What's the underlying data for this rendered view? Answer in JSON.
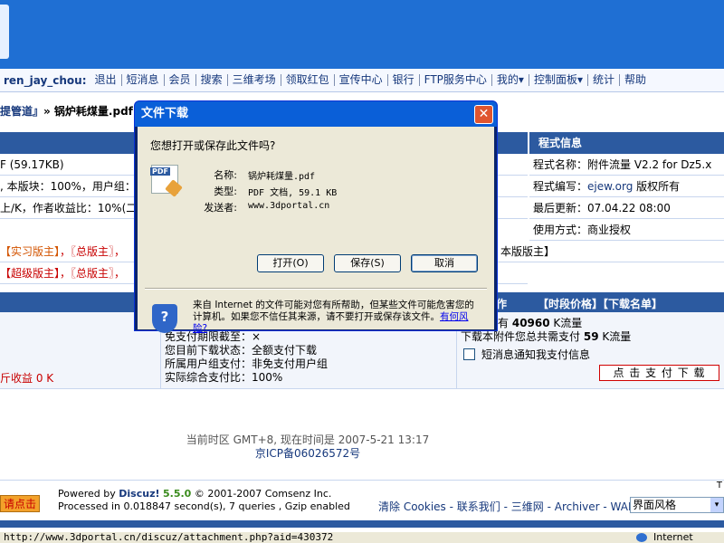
{
  "nav": {
    "username": "ren_jay_chou:",
    "items": [
      "退出",
      "短消息",
      "会员",
      "搜索",
      "三维考场",
      "领取红包",
      "宣传中心",
      "银行",
      "FTP服务中心",
      "我的▾",
      "控制面板▾",
      "统计",
      "帮助"
    ]
  },
  "breadcrumb": {
    "left": "提管道』",
    "file": "» 锅炉耗煤量.pdf"
  },
  "program_info": {
    "header": "程式信息",
    "name": "程式名称：附件流量 V2.2 for Dz5.x",
    "author_prefix": "程式编写：",
    "author_link": "ejew.org",
    "author_suffix": " 版权所有",
    "updated": "最后更新：07.04.22 08:00",
    "usage": "使用方式：商业授权"
  },
  "left_rows": {
    "row1": "F (59.17KB)",
    "row2": ", 本版块：100%，用户组：",
    "row3": "上/K，作者收益比：10%(二次",
    "row4_a": "【实习版主】",
    "row4_b": "，〖总版主〗，",
    "row4_c": "本版版主】",
    "row5_a": "【超级版主】",
    "row5_b": "，〖总版主〗，"
  },
  "lower": {
    "header_left": "作",
    "header_right": "【时段价格】【下载名单】",
    "free_period": "免支付期限截至：×",
    "download_status": "您目前下载状态：全额支付下载",
    "group_pay": "所属用户组支付：非免支付用户组",
    "actual_ratio": "实际综合支付比：100%",
    "left_income": "斤收益 0 K",
    "flow_prefix": "有",
    "flow_value": "40960",
    "flow_suffix": "K流量",
    "need_prefix": "下载本附件您总共需支付",
    "need_value": "59",
    "need_suffix": "K流量",
    "notify": "短消息通知我支付信息",
    "pay_button": "点 击 支 付 下 载"
  },
  "footer": {
    "timezone": "当前时区 GMT+8, 现在时间是 2007-5-21 13:17",
    "icp": "京ICP备06026572号",
    "left_button": "请点击",
    "powered_prefix": "Powered by ",
    "powered_brand": "Discuz!",
    "powered_version": "5.5.0",
    "copyright": "© 2001-2007 Comsenz Inc.",
    "processed": "Processed in 0.018847 second(s), 7 queries , Gzip enabled",
    "links": [
      "清除 Cookies",
      "联系我们",
      "三维网",
      "Archiver",
      "WAP"
    ],
    "style_select": "界面风格",
    "top_link": "T"
  },
  "statusbar": {
    "url": "http://www.3dportal.cn/discuz/attachment.php?aid=430372",
    "zone": "Internet"
  },
  "dialog": {
    "title": "文件下载",
    "question": "您想打开或保存此文件吗?",
    "name_label": "名称:",
    "name_value": "锅炉耗煤量.pdf",
    "type_label": "类型:",
    "type_value": "PDF 文档, 59.1 KB",
    "from_label": "发送者:",
    "from_value": "www.3dportal.cn",
    "open_button": "打开(O)",
    "save_button": "保存(S)",
    "cancel_button": "取消",
    "warning_text": "来自 Internet 的文件可能对您有所帮助，但某些文件可能危害您的计算机。如果您不信任其来源，请不要打开或保存该文件。",
    "risk_link": "有何风险?"
  },
  "colors": {
    "topbar": "#1f6fd3",
    "table_header": "#2c5aa0",
    "dialog_title": "#0a5fd8"
  }
}
